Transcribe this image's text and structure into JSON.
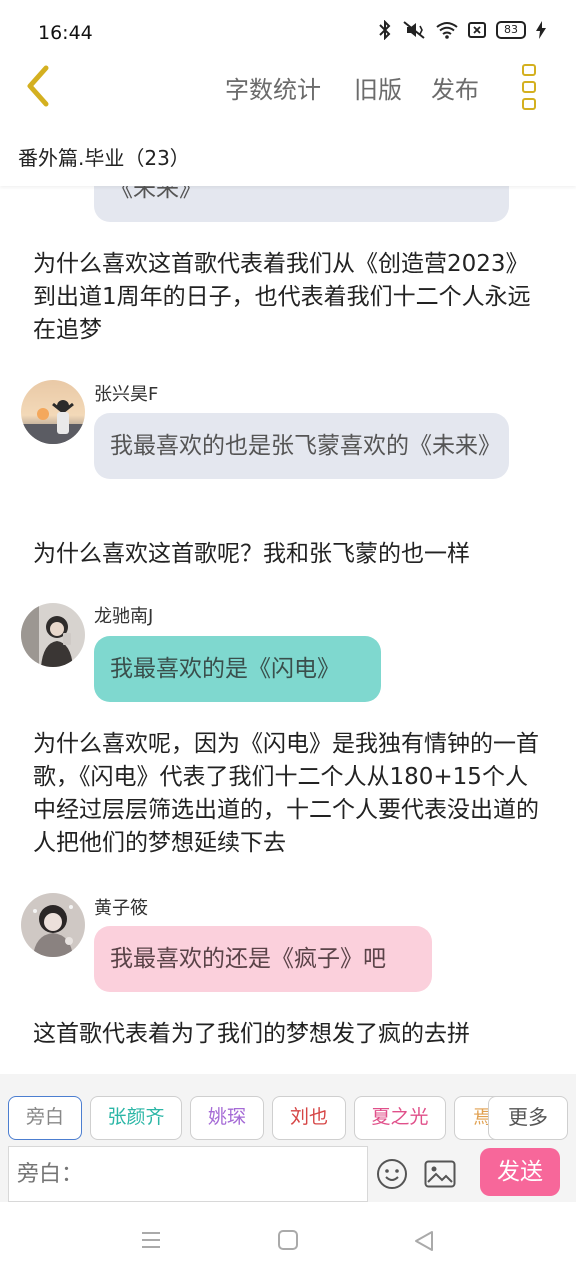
{
  "status_bar": {
    "time": "16:44",
    "battery": "83"
  },
  "header": {
    "word_count": "字数统计",
    "old_version": "旧版",
    "publish": "发布"
  },
  "chapter": {
    "title": "番外篇.毕业（23）"
  },
  "messages": {
    "partial_bubble": "《未来》",
    "narration_1": "为什么喜欢这首歌代表着我们从《创造营2023》到出道1周年的日子，也代表着我们十二个人永远在追梦",
    "speaker_1": "张兴昊F",
    "bubble_1": "我最喜欢的也是张飞蒙喜欢的《未来》",
    "narration_2": "为什么喜欢这首歌呢？我和张飞蒙的也一样",
    "speaker_2": "龙驰南J",
    "bubble_2": "我最喜欢的是《闪电》",
    "narration_3": "为什么喜欢呢，因为《闪电》是我独有情钟的一首歌，《闪电》代表了我们十二个人从180+15个人中经过层层筛选出道的，十二个人要代表没出道的人把他们的梦想延续下去",
    "speaker_3": "黄子筱",
    "bubble_3": "我最喜欢的还是《疯子》吧",
    "narration_4": "这首歌代表着为了我们的梦想发了疯的去拼"
  },
  "characters": [
    {
      "name": "旁白",
      "color": "#888888"
    },
    {
      "name": "张颜齐",
      "color": "#2bb6a6"
    },
    {
      "name": "姚琛",
      "color": "#a56bd6"
    },
    {
      "name": "刘也",
      "color": "#d64545"
    },
    {
      "name": "夏之光",
      "color": "#e0508a"
    },
    {
      "name": "焉",
      "color": "#e0a050"
    }
  ],
  "more_label": "更多",
  "input": {
    "placeholder": "旁白："
  },
  "send_label": "发送",
  "colors": {
    "accent_yellow": "#d4b020",
    "send_pink": "#f7679a",
    "bubble_gray": "#e4e7ef",
    "bubble_teal": "#7fd8cf",
    "bubble_pink": "#fbd0dc"
  }
}
